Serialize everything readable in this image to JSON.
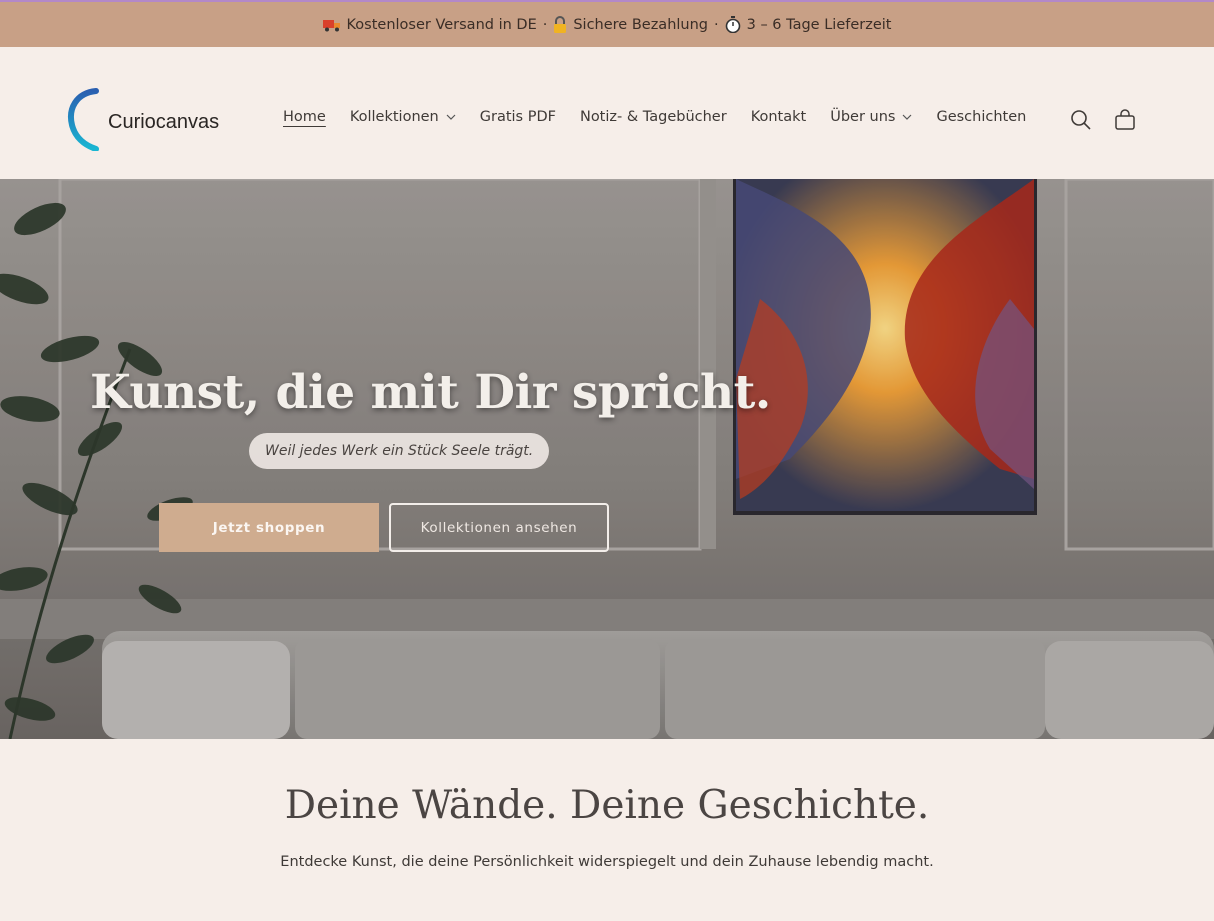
{
  "announcement": {
    "shipping": "Kostenloser Versand in DE",
    "payment": "Sichere Bezahlung",
    "delivery": "3 – 6 Tage Lieferzeit",
    "separator": "·",
    "icons": [
      "truck-icon",
      "lock-icon",
      "stopwatch-icon"
    ]
  },
  "header": {
    "brand": "Curiocanvas",
    "nav": [
      {
        "label": "Home",
        "active": true,
        "dropdown": false
      },
      {
        "label": "Kollektionen",
        "active": false,
        "dropdown": true
      },
      {
        "label": "Gratis PDF",
        "active": false,
        "dropdown": false
      },
      {
        "label": "Notiz- & Tagebücher",
        "active": false,
        "dropdown": false
      },
      {
        "label": "Kontakt",
        "active": false,
        "dropdown": false
      },
      {
        "label": "Über uns",
        "active": false,
        "dropdown": true
      },
      {
        "label": "Geschichten",
        "active": false,
        "dropdown": false
      }
    ],
    "icons": [
      "search-icon",
      "cart-icon"
    ]
  },
  "hero": {
    "title": "Kunst, die mit Dir spricht.",
    "subtitle": "Weil jedes Werk ein Stück Seele trägt.",
    "primary_button": "Jetzt shoppen",
    "secondary_button": "Kollektionen ansehen"
  },
  "section": {
    "title": "Deine Wände. Deine Geschichte.",
    "text": "Entdecke Kunst, die deine Persönlichkeit widerspiegelt und dein Zuhause lebendig macht."
  },
  "colors": {
    "announcement_bg": "#c8a086",
    "page_bg": "#f6eee9",
    "primary_button": "#cfac8f",
    "logo_gradient": [
      "#2a5fb0",
      "#19b6d2"
    ]
  }
}
